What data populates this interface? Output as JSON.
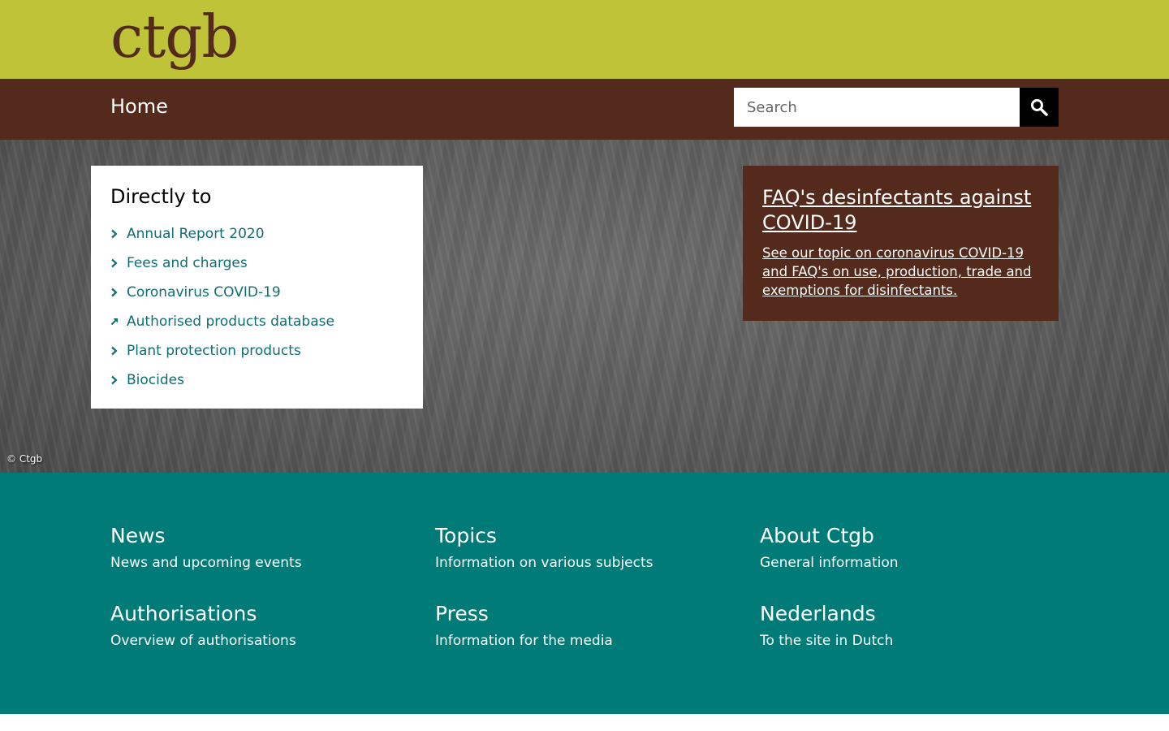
{
  "header": {
    "logo_text": "ctgb"
  },
  "nav": {
    "home_label": "Home"
  },
  "search": {
    "placeholder": "Search"
  },
  "directly_to": {
    "title": "Directly to",
    "items": [
      {
        "label": "Annual Report 2020",
        "icon": "chevron-right-icon"
      },
      {
        "label": "Fees and charges",
        "icon": "chevron-right-icon"
      },
      {
        "label": "Coronavirus COVID-19",
        "icon": "chevron-right-icon"
      },
      {
        "label": "Authorised products database",
        "icon": "external-link-icon"
      },
      {
        "label": "Plant protection products",
        "icon": "chevron-right-icon"
      },
      {
        "label": "Biocides",
        "icon": "chevron-right-icon"
      }
    ]
  },
  "faq": {
    "title": "FAQ's desinfectants against COVID-19",
    "text": "See our topic on coronavirus COVID-19 and FAQ's on use, production, trade and exemptions for disinfectants."
  },
  "hero": {
    "credit": "© Ctgb"
  },
  "footer": {
    "items": [
      {
        "heading": "News",
        "desc": "News and upcoming events"
      },
      {
        "heading": "Topics",
        "desc": "Information on various subjects"
      },
      {
        "heading": "About Ctgb",
        "desc": "General information"
      },
      {
        "heading": "Authorisations",
        "desc": "Overview of authorisations"
      },
      {
        "heading": "Press",
        "desc": "Information for the media"
      },
      {
        "heading": "Nederlands",
        "desc": "To the site in Dutch"
      }
    ]
  },
  "colors": {
    "header_green": "#bec337",
    "brand_brown": "#532a1b",
    "footer_teal": "#007b78",
    "link_teal": "#0f6e73"
  }
}
